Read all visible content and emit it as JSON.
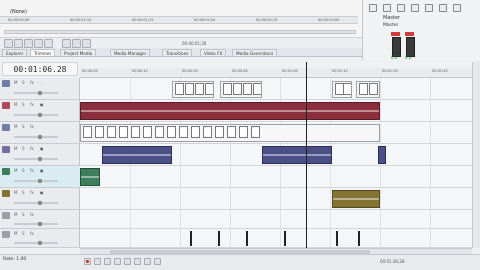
{
  "trimmer": {
    "title": "(None)",
    "ruler_ticks": [
      "00:00:00;00",
      "00:00:01;10",
      "00:00:01;15",
      "00:00:02;00",
      "00:00:02;15",
      "00:00:03;00"
    ],
    "time": "00:00:01;28"
  },
  "master": {
    "title": "Master",
    "bus_label": "Master",
    "left_value": "0.0",
    "right_value": "0.0",
    "accent": "#d43a3a"
  },
  "tabs": [
    {
      "label": "Explorer",
      "active": false
    },
    {
      "label": "Trimmer",
      "active": true
    },
    {
      "label": "Project Media",
      "active": false
    },
    {
      "label": "Media Manager",
      "active": false
    },
    {
      "label": "Transitions",
      "active": false
    },
    {
      "label": "Video FX",
      "active": false
    },
    {
      "label": "Media Generators",
      "active": false
    }
  ],
  "timeline": {
    "current_time": "00:01:06.28",
    "ruler_ticks": [
      "00:00:00",
      "00:00:15",
      "00:00:30",
      "00:00:45",
      "00:01:00",
      "00:01:15",
      "00:01:30",
      "00:01:45"
    ],
    "end_time": "00:01:36;28",
    "rate": "Rate: 1.00"
  },
  "tracks": [
    {
      "type": "video",
      "color": "#6f7fa8"
    },
    {
      "type": "audio",
      "color": "#b04a5a"
    },
    {
      "type": "video",
      "color": "#6f7fa8"
    },
    {
      "type": "audio",
      "color": "#7a6aa0"
    },
    {
      "type": "audio",
      "color": "#3d7f5a"
    },
    {
      "type": "audio",
      "color": "#847434"
    },
    {
      "type": "audio",
      "color": "#9aa0a7"
    },
    {
      "type": "audio",
      "color": "#9aa0a7"
    }
  ],
  "icons": {
    "mute": "mute-icon",
    "solo": "solo-icon",
    "fx": "fx-icon",
    "record": "record-icon",
    "play": "play-icon",
    "stop": "stop-icon"
  }
}
